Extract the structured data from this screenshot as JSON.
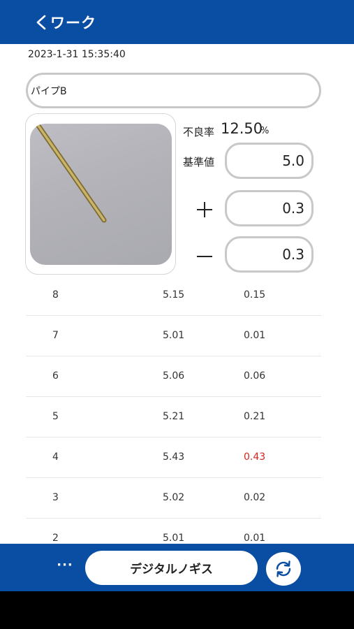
{
  "header": {
    "back_label": "ワーク",
    "back_icon": "chevron-left-icon"
  },
  "timestamp": "2023-1-31 15:35:40",
  "work_name": "パイプB",
  "stats": {
    "defect_rate_label": "不良率",
    "defect_rate_value": "12.50",
    "defect_rate_unit": "%",
    "standard_label": "基準値",
    "standard_value": "5.0",
    "plus_tolerance": "0.3",
    "minus_tolerance": "0.3"
  },
  "measurements": [
    {
      "no": "8",
      "value": "5.15",
      "deviation": "0.15",
      "ng": false
    },
    {
      "no": "7",
      "value": "5.01",
      "deviation": "0.01",
      "ng": false
    },
    {
      "no": "6",
      "value": "5.06",
      "deviation": "0.06",
      "ng": false
    },
    {
      "no": "5",
      "value": "5.21",
      "deviation": "0.21",
      "ng": false
    },
    {
      "no": "4",
      "value": "5.43",
      "deviation": "0.43",
      "ng": true
    },
    {
      "no": "3",
      "value": "5.02",
      "deviation": "0.02",
      "ng": false
    },
    {
      "no": "2",
      "value": "5.01",
      "deviation": "0.01",
      "ng": false
    }
  ],
  "footer": {
    "more_label": "···",
    "device_button_label": "デジタルノギス",
    "refresh_icon": "refresh-icon"
  },
  "colors": {
    "primary": "#0a4ea3",
    "ng": "#d9261c",
    "border": "#c8c8c8"
  }
}
